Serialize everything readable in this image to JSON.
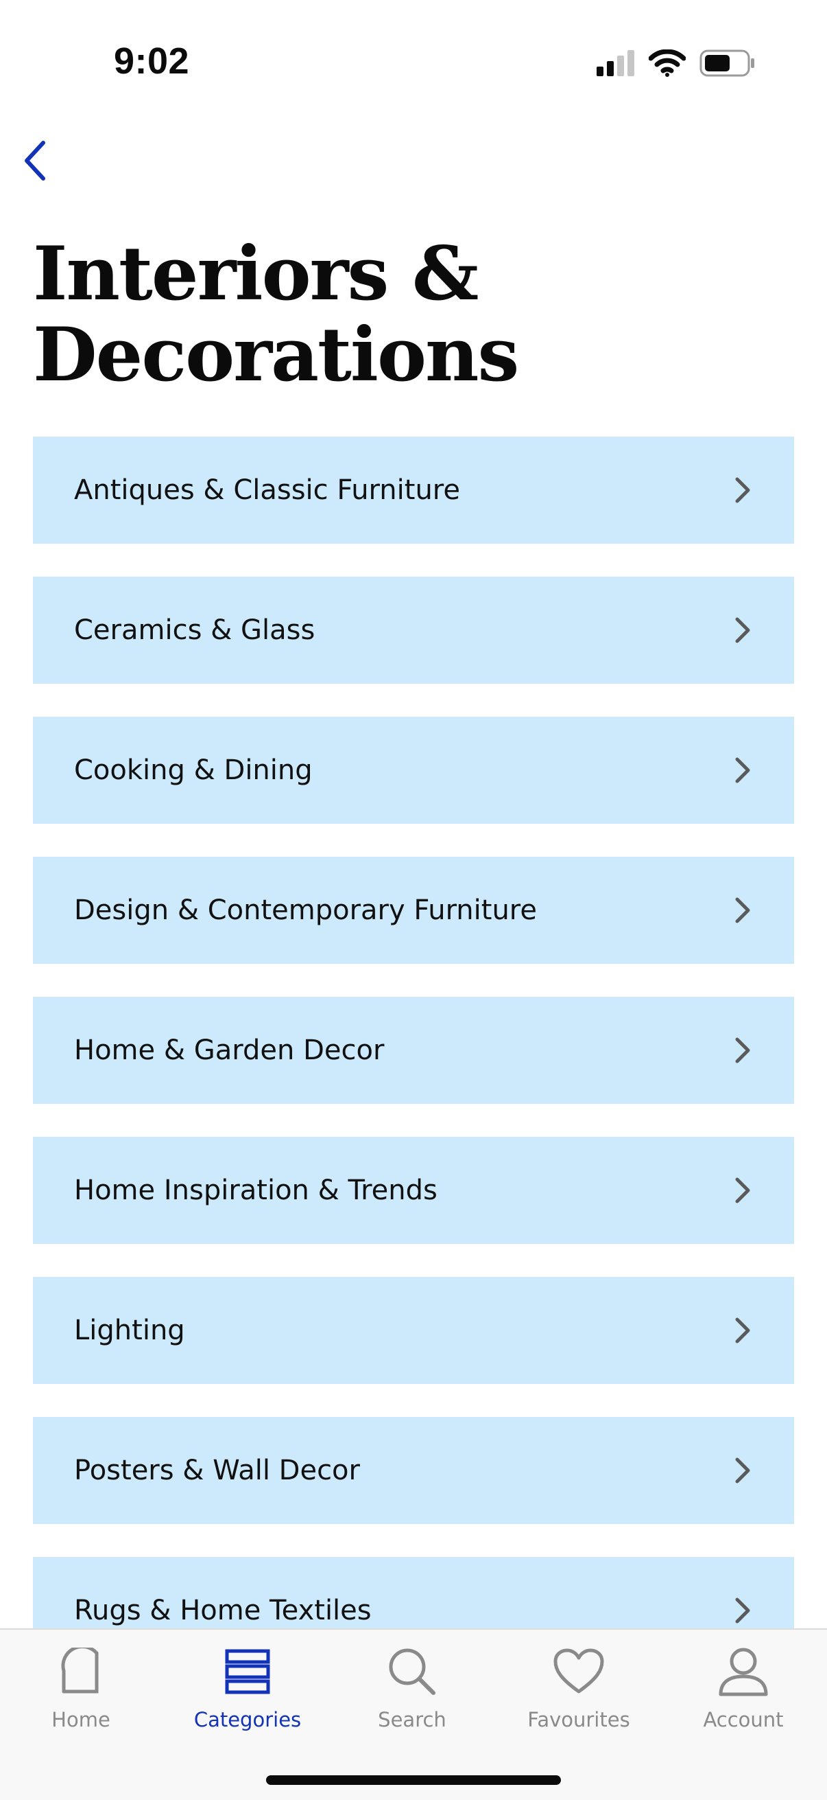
{
  "status_bar": {
    "time": "9:02",
    "icons": [
      "cellular-signal-icon",
      "wifi-icon",
      "battery-icon"
    ]
  },
  "header": {
    "back_icon": "chevron-left-icon",
    "title": "Interiors & Decorations"
  },
  "categories": [
    {
      "label": "Antiques & Classic Furniture"
    },
    {
      "label": "Ceramics & Glass"
    },
    {
      "label": "Cooking & Dining"
    },
    {
      "label": "Design & Contemporary Furniture"
    },
    {
      "label": "Home & Garden Decor"
    },
    {
      "label": "Home Inspiration & Trends"
    },
    {
      "label": "Lighting"
    },
    {
      "label": "Posters & Wall Decor"
    },
    {
      "label": "Rugs & Home Textiles"
    }
  ],
  "tab_bar": {
    "tabs": [
      {
        "label": "Home",
        "icon": "home-icon",
        "active": false
      },
      {
        "label": "Categories",
        "icon": "categories-icon",
        "active": true
      },
      {
        "label": "Search",
        "icon": "search-icon",
        "active": false
      },
      {
        "label": "Favourites",
        "icon": "heart-icon",
        "active": false
      },
      {
        "label": "Account",
        "icon": "account-icon",
        "active": false
      }
    ]
  },
  "colors": {
    "accent": "#1232b8",
    "item_background": "#cdeafd",
    "inactive_tab": "#8a8a8a",
    "text": "#0b0b0b"
  }
}
